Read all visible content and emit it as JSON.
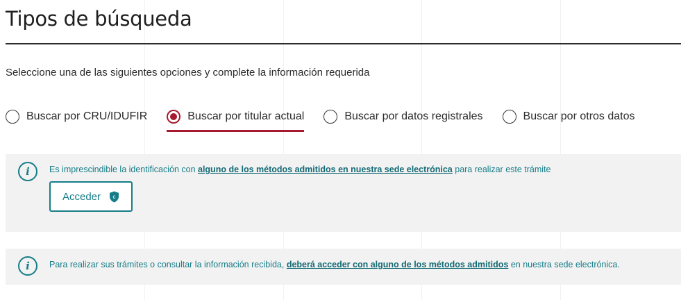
{
  "page": {
    "title": "Tipos de búsqueda",
    "subtitle": "Seleccione una de las siguientes opciones y complete la información requerida"
  },
  "search_types": [
    {
      "label": "Buscar por CRU/IDUFIR",
      "checked": false
    },
    {
      "label": "Buscar por titular actual",
      "checked": true
    },
    {
      "label": "Buscar por datos registrales",
      "checked": false
    },
    {
      "label": "Buscar por otros datos",
      "checked": false
    }
  ],
  "identification_notice": {
    "text_before": "Es imprescindible la identificación con ",
    "link_text": "alguno de los métodos admitidos en nuestra sede electrónica",
    "text_after": " para realizar este trámite",
    "button_label": "Acceder",
    "button_icon": "shield-c-icon"
  },
  "access_notice": {
    "text_before": "Para realizar sus trámites o consultar la información recibida, ",
    "link_text": "deberá acceder con alguno de los métodos admitidos",
    "text_after": " en nuestra sede electrónica."
  },
  "colors": {
    "accent_red": "#a6192e",
    "teal": "#167d88",
    "info_bg": "#f2f2f2"
  }
}
